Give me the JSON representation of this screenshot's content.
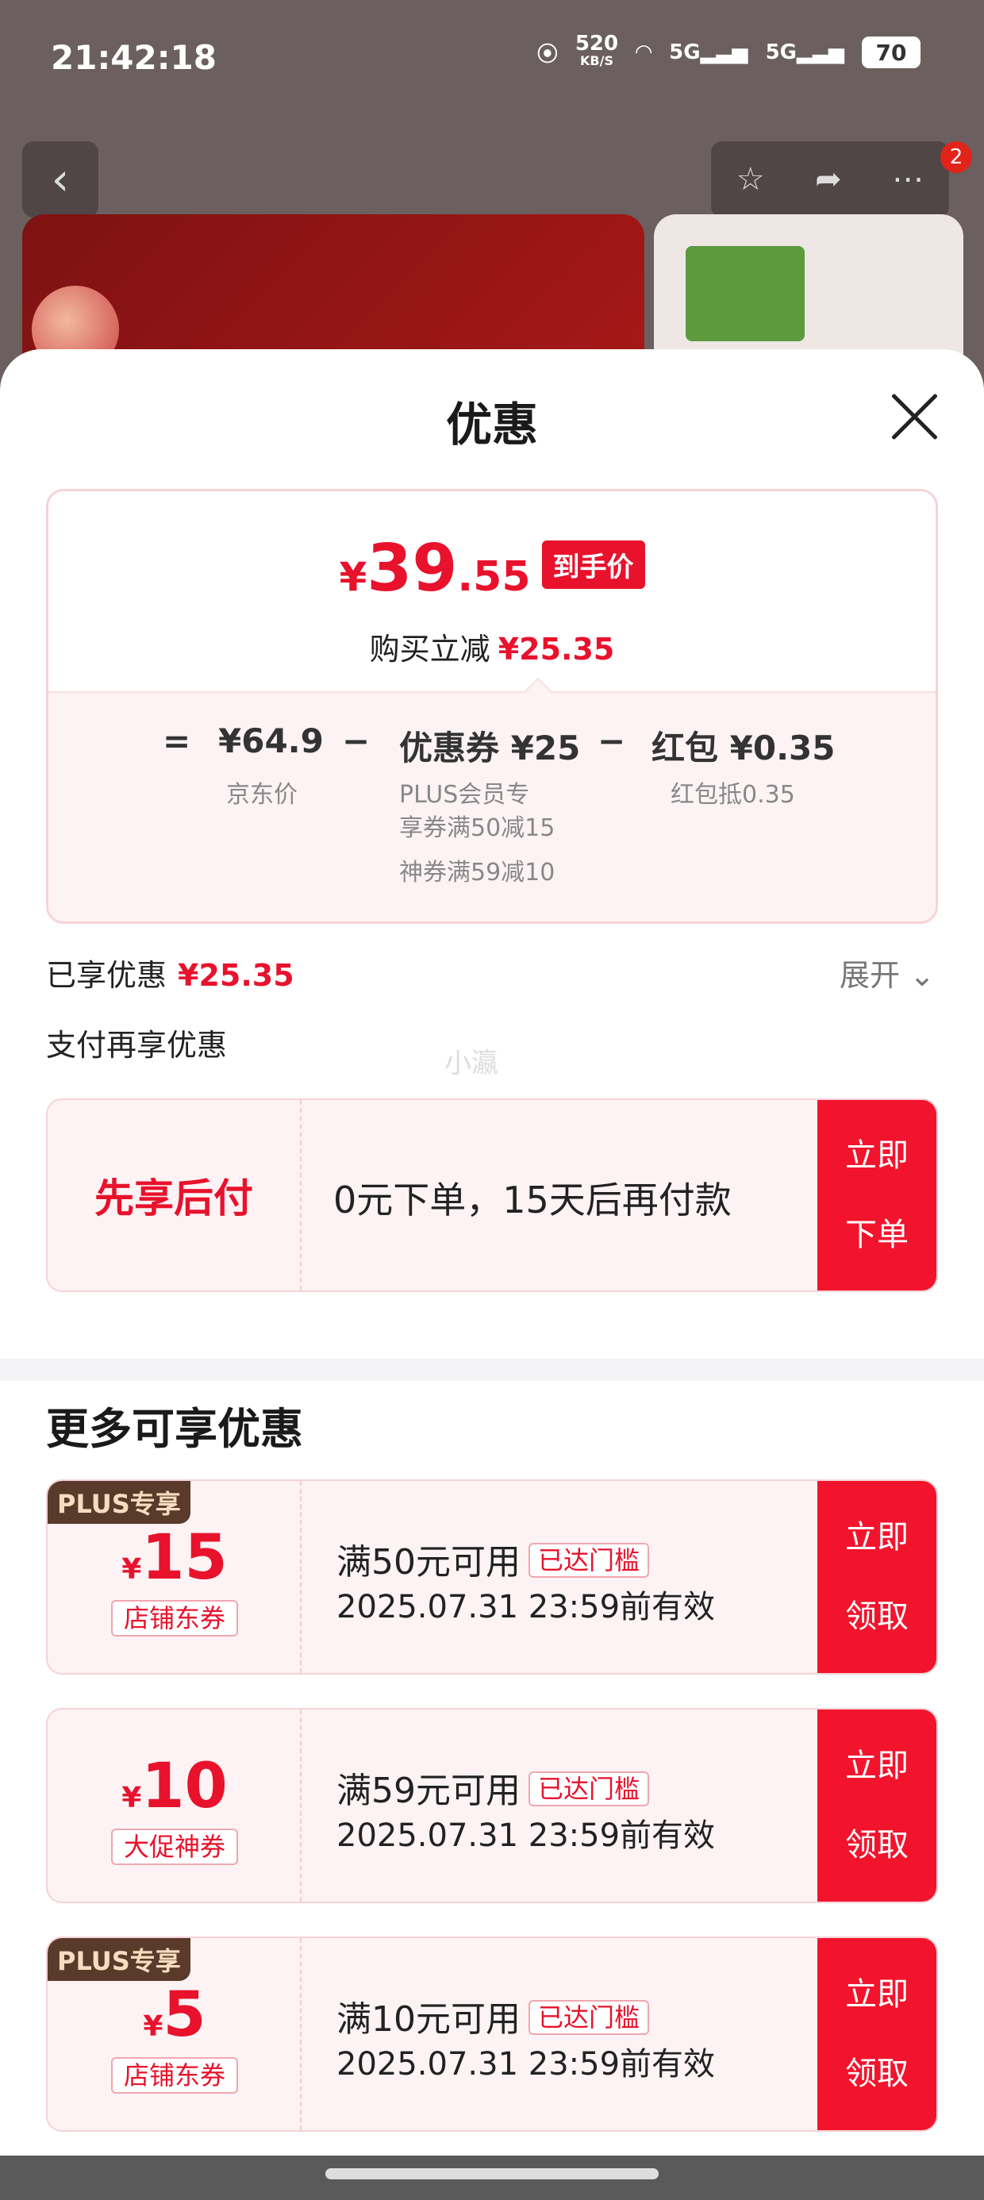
{
  "status_bar": {
    "time": "21:42:18",
    "net_speed": "520",
    "net_unit": "KB/S",
    "signal1": "5G",
    "signal2": "5G",
    "battery": "70"
  },
  "background": {
    "back_icon": "‹",
    "badge_count": "2"
  },
  "sheet": {
    "title": "优惠",
    "close_icon": "close-icon"
  },
  "price_card": {
    "yen": "¥",
    "price_int": "39",
    "price_dec": ".55",
    "tag": "到手价",
    "reduce_label": "购买立减",
    "reduce_amount": "¥25.35",
    "eq": "=",
    "jd_price": "¥64.9",
    "minus1": "−",
    "coupon_label": "优惠券 ¥25",
    "minus2": "−",
    "redpacket_label": "红包 ¥0.35",
    "jd_price_label": "京东价",
    "coupon_detail_1": "PLUS会员专",
    "coupon_detail_2": "享券满50减15",
    "coupon_detail_3": "神券满59减10",
    "redpacket_detail": "红包抵0.35"
  },
  "enjoyed": {
    "label": "已享优惠",
    "amount": "¥25.35",
    "expand": "展开"
  },
  "pay_more": {
    "label": "支付再享优惠",
    "watermark": "小瀛"
  },
  "bnpl": {
    "title": "先享后付",
    "desc": "0元下单，15天后再付款",
    "button_line1": "立即",
    "button_line2": "下单"
  },
  "more": {
    "title": "更多可享优惠"
  },
  "coupons": [
    {
      "plus_tag": "PLUS专享",
      "yen": "¥",
      "amount": "15",
      "type": "店铺东券",
      "condition": "满50元可用",
      "reached": "已达门槛",
      "validity": "2025.07.31 23:59前有效",
      "button_line1": "立即",
      "button_line2": "领取"
    },
    {
      "plus_tag": "",
      "yen": "¥",
      "amount": "10",
      "type": "大促神券",
      "condition": "满59元可用",
      "reached": "已达门槛",
      "validity": "2025.07.31 23:59前有效",
      "button_line1": "立即",
      "button_line2": "领取"
    },
    {
      "plus_tag": "PLUS专享",
      "yen": "¥",
      "amount": "5",
      "type": "店铺东券",
      "condition": "满10元可用",
      "reached": "已达门槛",
      "validity": "2025.07.31 23:59前有效",
      "button_line1": "立即",
      "button_line2": "领取"
    }
  ],
  "colors": {
    "accent_red": "#e8122c",
    "button_red": "#f2142d",
    "card_bg": "#fdf3f4"
  }
}
